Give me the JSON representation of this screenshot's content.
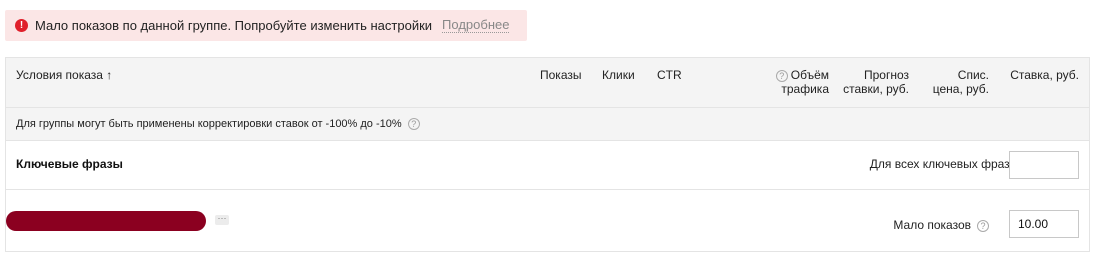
{
  "alert": {
    "icon": "exclamation-icon",
    "message": "Мало показов по данной группе. Попробуйте изменить настройки",
    "link": "Подробнее"
  },
  "table": {
    "headers": {
      "conditions": "Условия показа ↑",
      "impressions": "Показы",
      "clicks": "Клики",
      "ctr": "CTR",
      "traffic_line1": "Объём",
      "traffic_line2": "трафика",
      "forecast_line1": "Прогноз",
      "forecast_line2": "ставки, руб.",
      "writeoff_line1": "Спис.",
      "writeoff_line2": "цена, руб.",
      "bid": "Ставка, руб."
    },
    "info": "Для группы могут быть применены корректировки ставок от -100% до -10%",
    "group": {
      "title": "Ключевые фразы",
      "all_label": "Для всех ключевых фраз:",
      "all_value": ""
    },
    "keyword": {
      "more_label": "···",
      "status": "Мало показов",
      "bid": "10.00"
    }
  }
}
